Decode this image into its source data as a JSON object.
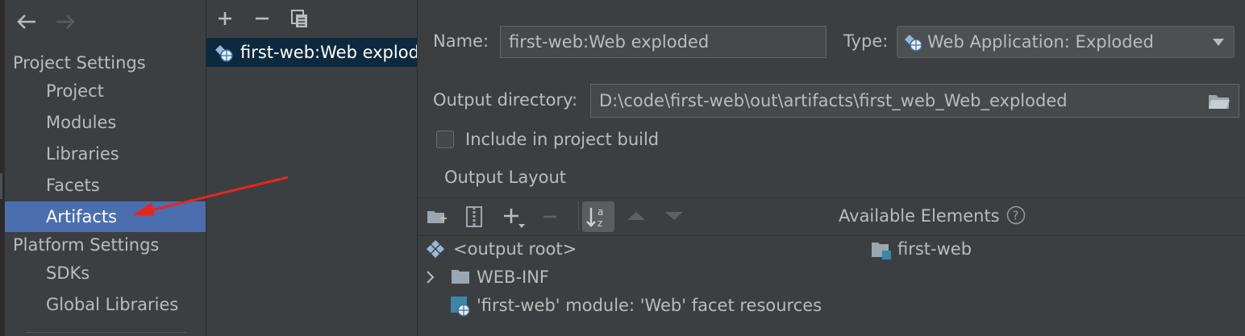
{
  "nav": {
    "back_icon": "back-arrow-icon",
    "forward_icon": "forward-arrow-icon",
    "project_settings_header": "Project Settings",
    "project_items": [
      "Project",
      "Modules",
      "Libraries",
      "Facets",
      "Artifacts"
    ],
    "selected_item": "Artifacts",
    "platform_settings_header": "Platform Settings",
    "platform_items": [
      "SDKs",
      "Global Libraries"
    ]
  },
  "artifacts_list": {
    "toolbar_icons": [
      "plus-icon",
      "minus-icon",
      "copy-icon"
    ],
    "items": [
      "first-web:Web exploded"
    ]
  },
  "artifact": {
    "name_label": "Name:",
    "name_value": "first-web:Web exploded",
    "type_label": "Type:",
    "type_value": "Web Application: Exploded",
    "output_dir_label": "Output directory:",
    "output_dir_value": "D:\\code\\first-web\\out\\artifacts\\first_web_Web_exploded",
    "include_in_build_label": "Include in project build",
    "include_in_build_checked": false,
    "output_layout_title": "Output Layout"
  },
  "layout": {
    "toolbar_icons": [
      "new-folder-icon",
      "archive-icon",
      "add-dropdown-icon",
      "remove-icon",
      "sort-alpha-icon",
      "move-up-icon",
      "move-down-icon"
    ],
    "tree": [
      {
        "label": "<output root>",
        "icon": "output-root-icon"
      },
      {
        "label": "WEB-INF",
        "icon": "folder-icon",
        "expandable": true
      },
      {
        "label": "'first-web' module: 'Web' facet resources",
        "icon": "web-facet-icon"
      }
    ],
    "available_elements_title": "Available Elements",
    "available_elements": [
      "first-web"
    ]
  },
  "annotation": {
    "arrow_color": "#e8261f"
  },
  "colors": {
    "background": "#3c3f41",
    "selection": "#4b6eaf",
    "list_selection": "#0d293e",
    "text": "#bbbbbb"
  }
}
